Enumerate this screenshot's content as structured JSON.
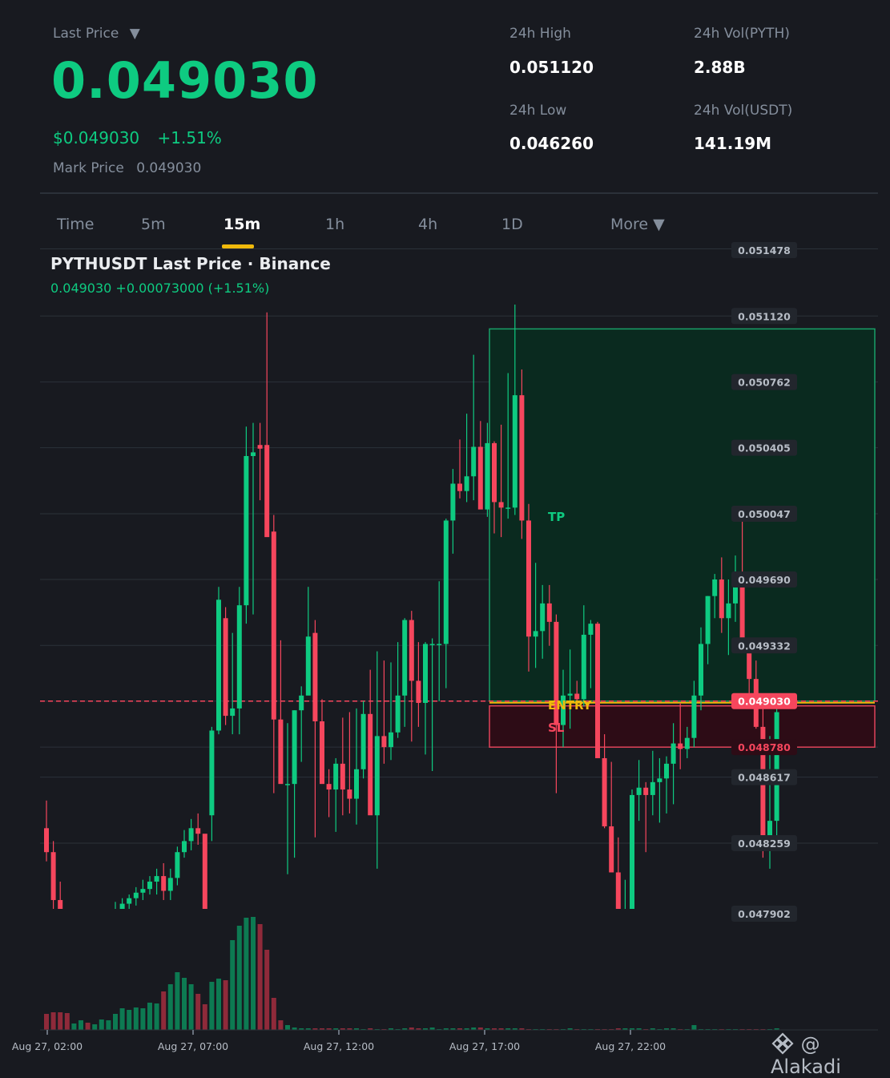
{
  "header": {
    "last_price_label": "Last Price",
    "last_price_caret": "▼",
    "last_price": "0.049030",
    "usd_price": "$0.049030",
    "change_pct": "+1.51%",
    "mark_price_label": "Mark Price",
    "mark_price": "0.049030"
  },
  "stats": {
    "high_label": "24h High",
    "high_value": "0.051120",
    "low_label": "24h Low",
    "low_value": "0.046260",
    "vol_base_label": "24h Vol(PYTH)",
    "vol_base_value": "2.88B",
    "vol_quote_label": "24h Vol(USDT)",
    "vol_quote_value": "141.19M"
  },
  "tabs": [
    {
      "label": "Time",
      "active": false
    },
    {
      "label": "5m",
      "active": false
    },
    {
      "label": "15m",
      "active": true
    },
    {
      "label": "1h",
      "active": false
    },
    {
      "label": "4h",
      "active": false
    },
    {
      "label": "1D",
      "active": false
    },
    {
      "label": "More ▼",
      "active": false
    }
  ],
  "chart_title": "PYTHUSDT Last Price · Binance",
  "chart_subtitle": "0.049030  +0.00073000 (+1.51%)",
  "logo_text": "@ Alakadi",
  "colors": {
    "up": "#0ecb81",
    "down": "#f6465d",
    "accent": "#f0b90b",
    "tp_zone": "#0a2a1f",
    "sl_zone": "#2d0c16"
  },
  "chart_data": {
    "type": "candlestick",
    "y_ticks": [
      "0.051478",
      "0.051120",
      "0.050762",
      "0.050405",
      "0.050047",
      "0.049690",
      "0.049332",
      "0.049030",
      "0.048780",
      "0.048617",
      "0.048259",
      "0.047902"
    ],
    "x_ticks": [
      "Aug 27, 02:00",
      "Aug 27, 07:00",
      "Aug 27, 12:00",
      "Aug 27, 17:00",
      "Aug 27, 22:00"
    ],
    "current_price": 0.04903,
    "zones": {
      "tp_label": "TP",
      "entry_label": "ENTRY",
      "sl_label": "SL",
      "tp": 0.05105,
      "entry": 0.04903,
      "sl": 0.04878
    },
    "candles": [
      [
        0.04834,
        0.04849,
        0.04816,
        0.04821,
        20
      ],
      [
        0.04821,
        0.04827,
        0.0479,
        0.04795,
        22
      ],
      [
        0.04795,
        0.04805,
        0.0477,
        0.04782,
        22
      ],
      [
        0.04782,
        0.0479,
        0.0477,
        0.04776,
        21
      ],
      [
        0.04776,
        0.04786,
        0.0477,
        0.0478,
        8
      ],
      [
        0.0478,
        0.04788,
        0.04772,
        0.04784,
        12
      ],
      [
        0.04784,
        0.04788,
        0.04772,
        0.04775,
        9
      ],
      [
        0.04775,
        0.04783,
        0.04765,
        0.0478,
        7
      ],
      [
        0.0478,
        0.04788,
        0.04776,
        0.04785,
        13
      ],
      [
        0.04785,
        0.0479,
        0.04778,
        0.04786,
        12
      ],
      [
        0.04786,
        0.04794,
        0.04782,
        0.0479,
        20
      ],
      [
        0.0479,
        0.04796,
        0.04786,
        0.04793,
        27
      ],
      [
        0.04793,
        0.04798,
        0.04786,
        0.04796,
        25
      ],
      [
        0.04796,
        0.04802,
        0.04792,
        0.04799,
        28
      ],
      [
        0.04799,
        0.04806,
        0.04795,
        0.04801,
        27
      ],
      [
        0.04801,
        0.04808,
        0.04798,
        0.04805,
        34
      ],
      [
        0.04805,
        0.04812,
        0.04798,
        0.04808,
        33
      ],
      [
        0.04808,
        0.04815,
        0.04795,
        0.048,
        48
      ],
      [
        0.048,
        0.04812,
        0.04795,
        0.04807,
        57
      ],
      [
        0.04807,
        0.04824,
        0.04803,
        0.04821,
        72
      ],
      [
        0.04821,
        0.04833,
        0.04818,
        0.04827,
        65
      ],
      [
        0.04827,
        0.04839,
        0.04822,
        0.04834,
        57
      ],
      [
        0.04834,
        0.04842,
        0.04825,
        0.04831,
        45
      ],
      [
        0.04831,
        0.0479,
        0.0479,
        0.0479,
        32
      ],
      [
        0.04841,
        0.04889,
        0.04827,
        0.04887,
        60
      ],
      [
        0.04887,
        0.04965,
        0.04885,
        0.04958,
        64
      ],
      [
        0.04948,
        0.04954,
        0.0489,
        0.04895,
        62
      ],
      [
        0.04895,
        0.0494,
        0.04885,
        0.04899,
        112
      ],
      [
        0.04899,
        0.04965,
        0.04885,
        0.04955,
        130
      ],
      [
        0.04955,
        0.05052,
        0.04945,
        0.05036,
        140
      ],
      [
        0.05036,
        0.05054,
        0.0495,
        0.05038,
        141
      ],
      [
        0.05042,
        0.05054,
        0.05012,
        0.0504,
        132
      ],
      [
        0.05042,
        0.05114,
        0.05003,
        0.04992,
        100
      ],
      [
        0.04995,
        0.05004,
        0.04853,
        0.04893,
        40
      ],
      [
        0.04893,
        0.04936,
        0.04868,
        0.04858,
        12
      ],
      [
        0.04858,
        0.04891,
        0.04809,
        0.04858,
        6
      ],
      [
        0.04858,
        0.04898,
        0.04818,
        0.04898,
        3
      ],
      [
        0.04898,
        0.04911,
        0.0487,
        0.04906,
        2
      ],
      [
        0.04906,
        0.04965,
        0.04911,
        0.04938,
        2
      ],
      [
        0.0494,
        0.04947,
        0.04829,
        0.04892,
        2
      ],
      [
        0.04892,
        0.04904,
        0.04866,
        0.04858,
        2
      ],
      [
        0.04858,
        0.04866,
        0.0484,
        0.04855,
        2
      ],
      [
        0.04855,
        0.04872,
        0.04832,
        0.04869,
        2
      ],
      [
        0.04869,
        0.04894,
        0.04841,
        0.04855,
        2
      ],
      [
        0.04855,
        0.04897,
        0.04842,
        0.0485,
        2
      ],
      [
        0.0485,
        0.04899,
        0.04836,
        0.04866,
        2
      ],
      [
        0.04866,
        0.04903,
        0.04861,
        0.04896,
        1
      ],
      [
        0.04896,
        0.0492,
        0.04842,
        0.04841,
        2
      ],
      [
        0.04841,
        0.0493,
        0.04812,
        0.04884,
        1
      ],
      [
        0.04884,
        0.04925,
        0.04869,
        0.04878,
        1
      ],
      [
        0.04878,
        0.04924,
        0.04871,
        0.04886,
        2
      ],
      [
        0.04886,
        0.04935,
        0.04883,
        0.04906,
        1
      ],
      [
        0.04906,
        0.04948,
        0.04889,
        0.04947,
        2
      ],
      [
        0.04947,
        0.04952,
        0.04881,
        0.04914,
        3
      ],
      [
        0.04914,
        0.04935,
        0.04889,
        0.04902,
        2
      ],
      [
        0.04902,
        0.04935,
        0.04874,
        0.04934,
        2
      ],
      [
        0.04934,
        0.04937,
        0.04865,
        0.04934,
        3
      ],
      [
        0.04934,
        0.04968,
        0.04903,
        0.04934,
        1
      ],
      [
        0.04934,
        0.05002,
        0.0491,
        0.05001,
        2
      ],
      [
        0.05001,
        0.05029,
        0.04983,
        0.05021,
        2
      ],
      [
        0.05021,
        0.05045,
        0.05013,
        0.05017,
        2
      ],
      [
        0.05017,
        0.05059,
        0.05011,
        0.05025,
        2
      ],
      [
        0.05025,
        0.05091,
        0.05012,
        0.05041,
        3
      ],
      [
        0.05041,
        0.05055,
        0.05008,
        0.05007,
        3
      ],
      [
        0.05007,
        0.05054,
        0.05003,
        0.05043,
        2
      ],
      [
        0.05043,
        0.05044,
        0.04994,
        0.05011,
        2
      ],
      [
        0.05011,
        0.05053,
        0.04992,
        0.05008,
        2
      ],
      [
        0.05008,
        0.05081,
        0.05002,
        0.05008,
        2
      ],
      [
        0.05008,
        0.05124,
        0.05004,
        0.05069,
        2
      ],
      [
        0.05069,
        0.05083,
        0.04991,
        0.05001,
        2
      ],
      [
        0.05001,
        0.0501,
        0.04919,
        0.04938,
        1
      ],
      [
        0.04938,
        0.04978,
        0.04921,
        0.04941,
        1
      ],
      [
        0.04941,
        0.04966,
        0.04926,
        0.04956,
        1
      ],
      [
        0.04956,
        0.04966,
        0.04933,
        0.04946,
        1
      ],
      [
        0.04946,
        0.0495,
        0.04853,
        0.0489,
        1
      ],
      [
        0.0489,
        0.0492,
        0.04878,
        0.04906,
        1
      ],
      [
        0.04906,
        0.04931,
        0.04888,
        0.04907,
        2
      ],
      [
        0.04907,
        0.04914,
        0.04899,
        0.04904,
        1
      ],
      [
        0.04904,
        0.04955,
        0.049,
        0.04939,
        1
      ],
      [
        0.04939,
        0.04947,
        0.0491,
        0.04945,
        1
      ],
      [
        0.04945,
        0.04946,
        0.04876,
        0.04872,
        1
      ],
      [
        0.04872,
        0.04885,
        0.04834,
        0.04835,
        1
      ],
      [
        0.04835,
        0.0487,
        0.04821,
        0.0481,
        1
      ],
      [
        0.0481,
        0.04829,
        0.04782,
        0.04788,
        2
      ],
      [
        0.04788,
        0.04806,
        0.0478,
        0.0479,
        2
      ],
      [
        0.0479,
        0.04855,
        0.04788,
        0.04852,
        2
      ],
      [
        0.04852,
        0.04871,
        0.04838,
        0.04856,
        2
      ],
      [
        0.04856,
        0.04859,
        0.04821,
        0.04852,
        1
      ],
      [
        0.04852,
        0.04876,
        0.04841,
        0.04859,
        2
      ],
      [
        0.04859,
        0.04872,
        0.04837,
        0.04861,
        1
      ],
      [
        0.04861,
        0.04873,
        0.04842,
        0.04869,
        2
      ],
      [
        0.04869,
        0.04891,
        0.04847,
        0.0488,
        2
      ],
      [
        0.0488,
        0.04902,
        0.04866,
        0.04877,
        1
      ],
      [
        0.04877,
        0.04889,
        0.04872,
        0.04883,
        1
      ],
      [
        0.04883,
        0.04914,
        0.04878,
        0.04906,
        6
      ],
      [
        0.04906,
        0.04943,
        0.04898,
        0.04934,
        1
      ],
      [
        0.04934,
        0.0496,
        0.04923,
        0.0496,
        1
      ],
      [
        0.0496,
        0.04972,
        0.04948,
        0.04969,
        1
      ],
      [
        0.04969,
        0.04981,
        0.0494,
        0.04948,
        1
      ],
      [
        0.04948,
        0.04969,
        0.04928,
        0.04956,
        1
      ],
      [
        0.04956,
        0.04982,
        0.04946,
        0.0497,
        1
      ],
      [
        0.0497,
        0.05008,
        0.04943,
        0.04929,
        1
      ],
      [
        0.04929,
        0.04935,
        0.04904,
        0.04915,
        1
      ],
      [
        0.04915,
        0.04925,
        0.04888,
        0.04889,
        1
      ],
      [
        0.04889,
        0.04902,
        0.04818,
        0.04827,
        1
      ],
      [
        0.04827,
        0.04884,
        0.04812,
        0.04838,
        1
      ],
      [
        0.04838,
        0.04904,
        0.04828,
        0.04897,
        2
      ]
    ]
  }
}
